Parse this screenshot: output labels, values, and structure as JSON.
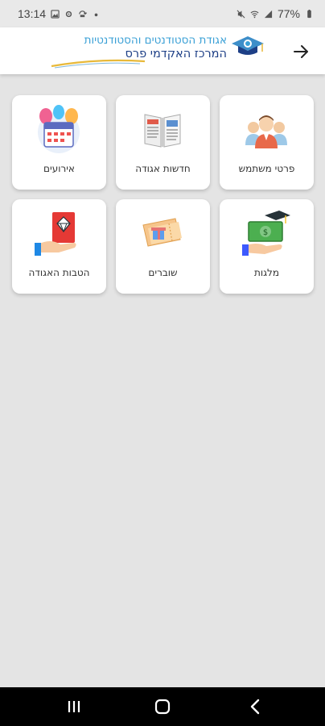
{
  "status_bar": {
    "time": "13:14",
    "battery": "77%"
  },
  "header": {
    "org_line1": "אגודת הסטודנטים והסטודנטיות",
    "org_line2": "המרכז האקדמי פרס",
    "back_icon": "arrow-right-icon"
  },
  "tiles": [
    {
      "label": "פרטי משתמש",
      "icon": "users-icon"
    },
    {
      "label": "חדשות אגודה",
      "icon": "newspaper-icon"
    },
    {
      "label": "אירועים",
      "icon": "calendar-balloons-icon"
    },
    {
      "label": "מלגות",
      "icon": "scholarship-money-icon"
    },
    {
      "label": "שוברים",
      "icon": "voucher-gift-icon"
    },
    {
      "label": "הטבות האגודה",
      "icon": "gift-hand-icon"
    }
  ],
  "nav": {
    "recents_icon": "recents-icon",
    "home_icon": "home-icon",
    "back_icon": "back-icon"
  },
  "colors": {
    "background": "#e4e4e4",
    "header_blue_light": "#3aa0d6",
    "header_blue_dark": "#1d3f86",
    "nav_bar": "#000000"
  }
}
